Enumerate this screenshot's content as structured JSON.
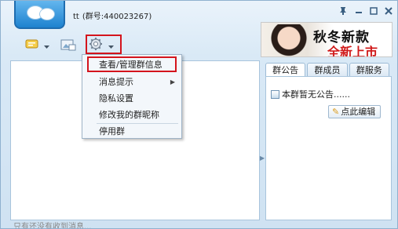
{
  "window": {
    "title_name": "tt",
    "title_group_number": "(群号:440023267)",
    "controls": [
      "pin-icon",
      "minimize-icon",
      "maximize-icon",
      "close-icon"
    ]
  },
  "toolbar": {
    "icons": [
      "message-icon",
      "image-icon",
      "gear-icon"
    ],
    "dropdown_arrows": true
  },
  "ad": {
    "line1": "秋冬新款",
    "line2": "全新上市"
  },
  "context_menu": {
    "items": [
      {
        "label": "查看/管理群信息",
        "highlighted": true
      },
      {
        "label": "消息提示",
        "has_submenu": true
      },
      {
        "label": "隐私设置"
      },
      {
        "label": "修改我的群昵称"
      },
      {
        "label": "停用群"
      }
    ]
  },
  "chat": {
    "footer_text": "只有还没有收到消息..."
  },
  "right_panel": {
    "tabs": [
      {
        "label": "群公告",
        "active": true
      },
      {
        "label": "群成员"
      },
      {
        "label": "群服务"
      }
    ],
    "notice_text": "本群暂无公告......",
    "edit_button": "点此编辑"
  },
  "colors": {
    "highlight_border": "#d4141c",
    "window_bg": "#d9e9f6",
    "accent_blue": "#1e82cf"
  }
}
